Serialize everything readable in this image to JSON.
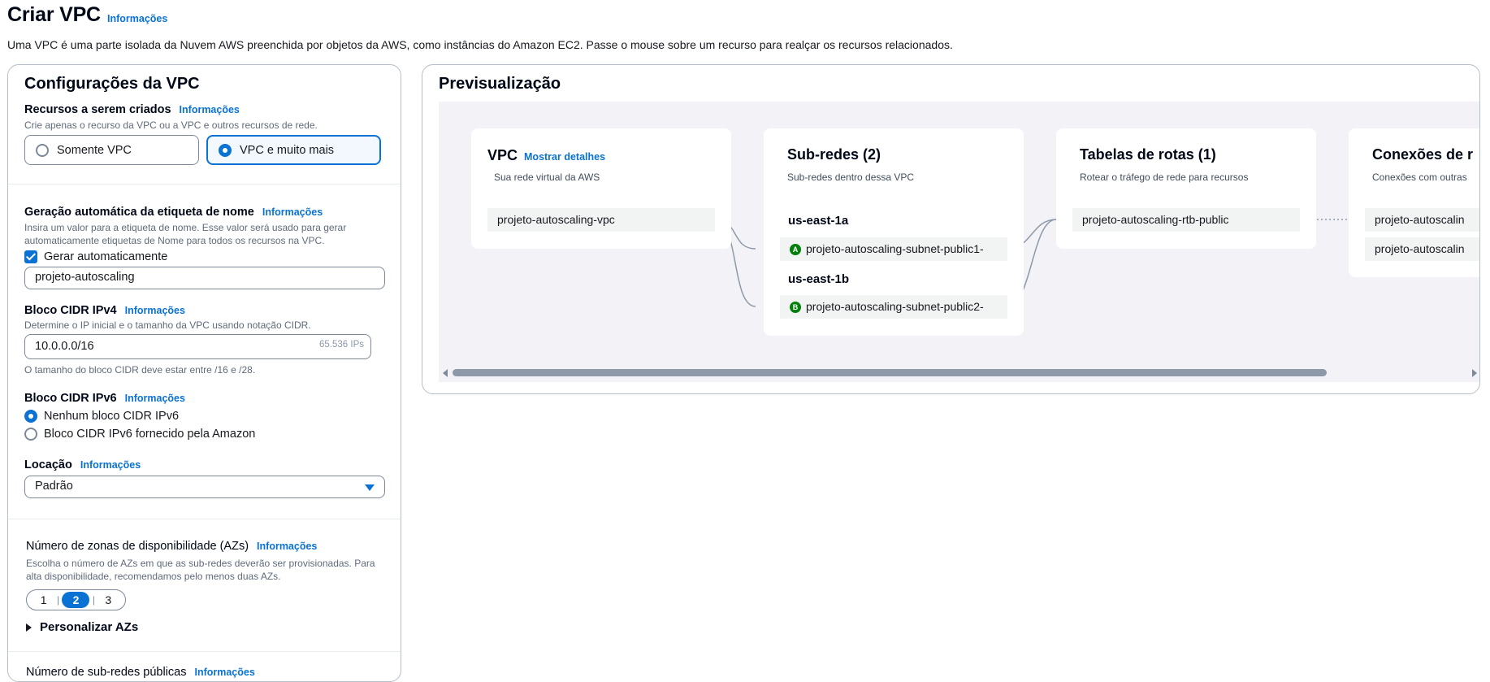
{
  "header": {
    "title": "Criar VPC",
    "info_link": "Informações",
    "description": "Uma VPC é uma parte isolada da Nuvem AWS preenchida por objetos da AWS, como instâncias do Amazon EC2. Passe o mouse sobre um recurso para realçar os recursos relacionados."
  },
  "config": {
    "title": "Configurações da VPC",
    "resources": {
      "label": "Recursos a serem criados",
      "info": "Informações",
      "description": "Crie apenas o recurso da VPC ou a VPC e outros recursos de rede.",
      "options": [
        "Somente VPC",
        "VPC e muito mais"
      ],
      "selected": "VPC e muito mais"
    },
    "name_tag": {
      "label": "Geração automática da etiqueta de nome",
      "info": "Informações",
      "description": "Insira um valor para a etiqueta de nome. Esse valor será usado para gerar automaticamente etiquetas de Nome para todos os recursos na VPC.",
      "checkbox_label": "Gerar automaticamente",
      "checked": true,
      "value": "projeto-autoscaling"
    },
    "ipv4": {
      "label": "Bloco CIDR IPv4",
      "info": "Informações",
      "description": "Determine o IP inicial e o tamanho da VPC usando notação CIDR.",
      "value": "10.0.0.0/16",
      "suffix": "65.536 IPs",
      "constraint": "O tamanho do bloco CIDR deve estar entre /16 e /28."
    },
    "ipv6": {
      "label": "Bloco CIDR IPv6",
      "info": "Informações",
      "options": [
        "Nenhum bloco CIDR IPv6",
        "Bloco CIDR IPv6 fornecido pela Amazon"
      ],
      "selected": "Nenhum bloco CIDR IPv6"
    },
    "tenancy": {
      "label": "Locação",
      "info": "Informações",
      "value": "Padrão"
    },
    "azs": {
      "label": "Número de zonas de disponibilidade (AZs)",
      "info": "Informações",
      "description": "Escolha o número de AZs em que as sub-redes deverão ser provisionadas. Para alta disponibilidade, recomendamos pelo menos duas AZs.",
      "options": [
        "1",
        "2",
        "3"
      ],
      "selected": "2",
      "customize": "Personalizar AZs"
    },
    "public_subnets": {
      "label": "Número de sub-redes públicas",
      "info": "Informações"
    }
  },
  "preview": {
    "title": "Previsualização",
    "vpc": {
      "title": "VPC",
      "details_link": "Mostrar detalhes",
      "subtitle": "Sua rede virtual da AWS",
      "item": "projeto-autoscaling-vpc"
    },
    "subnets": {
      "title": "Sub-redes (2)",
      "subtitle": "Sub-redes dentro dessa VPC",
      "zones": [
        {
          "name": "us-east-1a",
          "badge": "A",
          "subnet": "projeto-autoscaling-subnet-public1-"
        },
        {
          "name": "us-east-1b",
          "badge": "B",
          "subnet": "projeto-autoscaling-subnet-public2-"
        }
      ]
    },
    "route_tables": {
      "title": "Tabelas de rotas (1)",
      "subtitle": "Rotear o tráfego de rede para recursos",
      "item": "projeto-autoscaling-rtb-public"
    },
    "connections": {
      "title": "Conexões de r",
      "subtitle": "Conexões com outras",
      "items": [
        "projeto-autoscalin",
        "projeto-autoscalin"
      ]
    }
  },
  "colors": {
    "link": "#0972d3",
    "selected_border": "#0972d3",
    "az_badge": "#037f0c",
    "preview_background": "#f3f3f7"
  }
}
